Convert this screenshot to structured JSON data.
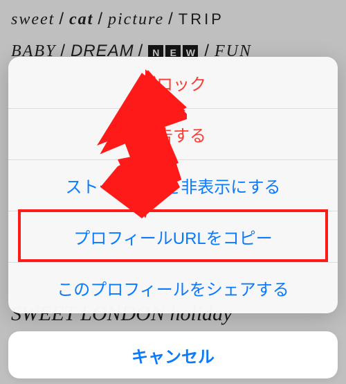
{
  "background": {
    "line1": {
      "w1": "sweet",
      "w2": "cat",
      "w3": "picture",
      "w4": "TRIP"
    },
    "line2": {
      "w5": "BABY",
      "w6": "DREAM",
      "w7_letters": [
        "N",
        "E",
        "W"
      ],
      "w8": "FUN"
    },
    "bottom": "SWEET   LONDON   holiday"
  },
  "sheet": {
    "block": "ブロック",
    "report": "報告する",
    "hide_stories": "ストーリーズを非表示にする",
    "copy_profile_url": "プロフィールURLをコピー",
    "share_profile": "このプロフィールをシェアする"
  },
  "cancel": "キャンセル"
}
